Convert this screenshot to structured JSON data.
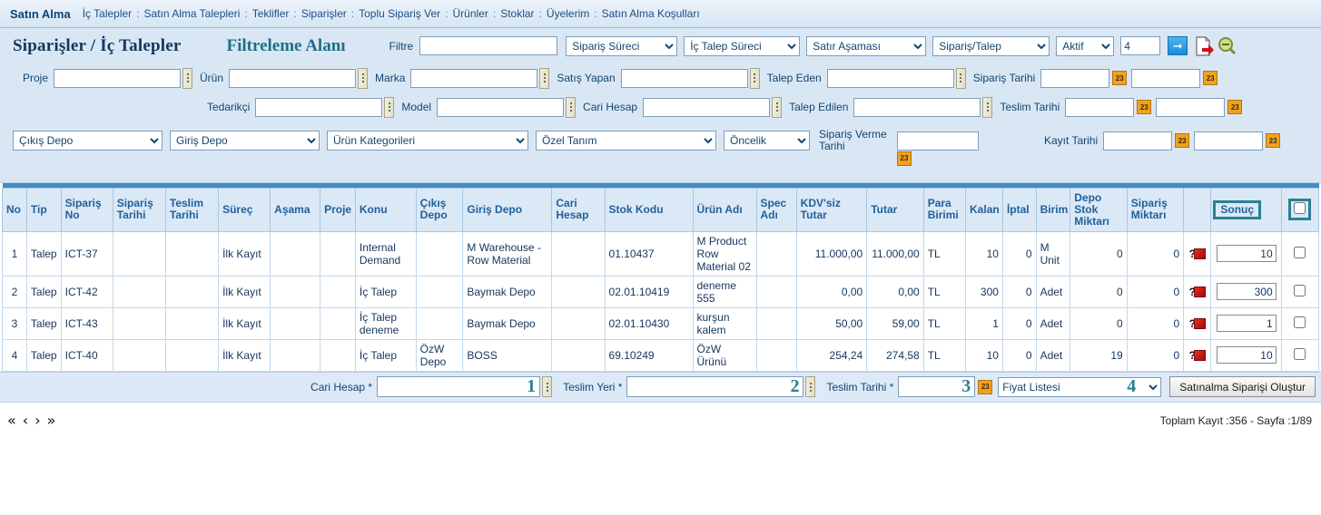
{
  "nav": {
    "brand": "Satın Alma",
    "separator": ":",
    "items": [
      "İç Talepler",
      "Satın Alma Talepleri",
      "Teklifler",
      "Siparişler",
      "Toplu Sipariş Ver",
      "Ürünler",
      "Stoklar",
      "Üyelerim",
      "Satın Alma Koşulları"
    ]
  },
  "header": {
    "page_title": "Siparişler / İç Talepler",
    "filter_area_title": "Filtreleme Alanı",
    "filter_label": "Filtre",
    "filter_value": "",
    "selects": [
      {
        "name": "siparis-sureci",
        "value": "Sipariş Süreci"
      },
      {
        "name": "ic-talep-sureci",
        "value": "İç Talep Süreci"
      },
      {
        "name": "satir-asamasi",
        "value": "Satır Aşaması"
      },
      {
        "name": "siparis-talep",
        "value": "Sipariş/Talep"
      },
      {
        "name": "aktif",
        "value": "Aktif"
      }
    ],
    "count_value": "4",
    "go_icon": "arrow-right-icon",
    "export_icon": "export-document-icon",
    "zoom_icon": "zoom-out-icon"
  },
  "filters": {
    "row1": [
      {
        "label": "Proje",
        "value": "",
        "picker": true
      },
      {
        "label": "Ürün",
        "value": "",
        "picker": true
      },
      {
        "label": "Marka",
        "value": "",
        "picker": true
      },
      {
        "label": "Satış Yapan",
        "value": "",
        "picker": true
      },
      {
        "label": "Talep Eden",
        "value": "",
        "picker": true
      }
    ],
    "row1_date": {
      "label": "Sipariş Tarihi",
      "from": "",
      "to": ""
    },
    "row2": [
      {
        "label": "Tedarikçi",
        "value": "",
        "picker": true
      },
      {
        "label": "Model",
        "value": "",
        "picker": true
      },
      {
        "label": "Cari Hesap",
        "value": "",
        "picker": true
      },
      {
        "label": "Talep Edilen",
        "value": "",
        "picker": true
      }
    ],
    "row2_date": {
      "label": "Teslim Tarihi",
      "from": "",
      "to": ""
    },
    "row3_selects": [
      {
        "name": "cikis-depo",
        "value": "Çıkış Depo"
      },
      {
        "name": "giris-depo",
        "value": "Giriş Depo"
      },
      {
        "name": "urun-kategorileri",
        "value": "Ürün Kategorileri"
      },
      {
        "name": "ozel-tanim",
        "value": "Özel Tanım"
      },
      {
        "name": "oncelik",
        "value": "Öncelik"
      }
    ],
    "siparis_verme_tarihi": {
      "label": "Sipariş Verme Tarihi",
      "value": ""
    },
    "kayit_tarihi": {
      "label": "Kayıt Tarihi",
      "from": "",
      "to": ""
    },
    "calendar_icon_label": "23"
  },
  "table": {
    "columns": [
      "No",
      "Tip",
      "Sipariş No",
      "Sipariş Tarihi",
      "Teslim Tarihi",
      "Süreç",
      "Aşama",
      "Proje",
      "Konu",
      "Çıkış Depo",
      "Giriş Depo",
      "Cari Hesap",
      "Stok Kodu",
      "Ürün Adı",
      "Spec Adı",
      "KDV'siz Tutar",
      "Tutar",
      "Para Birimi",
      "Kalan",
      "İptal",
      "Birim",
      "Depo Stok Miktarı",
      "Sipariş Miktarı",
      "",
      "Sonuç",
      ""
    ],
    "select_all_checked": false,
    "rows": [
      {
        "no": "1",
        "tip": "Talep",
        "siparis_no": "ICT-37",
        "siparis_tarihi": "",
        "teslim_tarihi": "",
        "surec": "İlk Kayıt",
        "asama": "",
        "proje": "",
        "konu": "Internal Demand",
        "cikis_depo": "",
        "giris_depo": "M Warehouse - Row Material",
        "cari_hesap": "",
        "stok_kodu": "01.10437",
        "urun_adi": "M Product Row Material 02",
        "spec_adi": "",
        "kdvsiz_tutar": "11.000,00",
        "tutar": "11.000,00",
        "para_birimi": "TL",
        "kalan": "10",
        "iptal": "0",
        "birim": "M Unit",
        "depo_stok_miktari": "0",
        "siparis_miktari": "0",
        "status_icon": "question-box-icon",
        "sonuc": "10",
        "checked": false
      },
      {
        "no": "2",
        "tip": "Talep",
        "siparis_no": "ICT-42",
        "siparis_tarihi": "",
        "teslim_tarihi": "",
        "surec": "İlk Kayıt",
        "asama": "",
        "proje": "",
        "konu": "İç Talep",
        "cikis_depo": "",
        "giris_depo": "Baymak Depo",
        "cari_hesap": "",
        "stok_kodu": "02.01.10419",
        "urun_adi": "deneme 555",
        "spec_adi": "",
        "kdvsiz_tutar": "0,00",
        "tutar": "0,00",
        "para_birimi": "TL",
        "kalan": "300",
        "iptal": "0",
        "birim": "Adet",
        "depo_stok_miktari": "0",
        "siparis_miktari": "0",
        "status_icon": "question-box-icon",
        "sonuc": "300",
        "checked": false
      },
      {
        "no": "3",
        "tip": "Talep",
        "siparis_no": "ICT-43",
        "siparis_tarihi": "",
        "teslim_tarihi": "",
        "surec": "İlk Kayıt",
        "asama": "",
        "proje": "",
        "konu": "İç Talep deneme",
        "cikis_depo": "",
        "giris_depo": "Baymak Depo",
        "cari_hesap": "",
        "stok_kodu": "02.01.10430",
        "urun_adi": "kurşun kalem",
        "spec_adi": "",
        "kdvsiz_tutar": "50,00",
        "tutar": "59,00",
        "para_birimi": "TL",
        "kalan": "1",
        "iptal": "0",
        "birim": "Adet",
        "depo_stok_miktari": "0",
        "siparis_miktari": "0",
        "status_icon": "question-box-icon",
        "sonuc": "1",
        "checked": false
      },
      {
        "no": "4",
        "tip": "Talep",
        "siparis_no": "ICT-40",
        "siparis_tarihi": "",
        "teslim_tarihi": "",
        "surec": "İlk Kayıt",
        "asama": "",
        "proje": "",
        "konu": "İç Talep",
        "cikis_depo": "ÖzW Depo",
        "giris_depo": "BOSS",
        "cari_hesap": "",
        "stok_kodu": "69.10249",
        "urun_adi": "ÖzW Ürünü",
        "spec_adi": "",
        "kdvsiz_tutar": "254,24",
        "tutar": "274,58",
        "para_birimi": "TL",
        "kalan": "10",
        "iptal": "0",
        "birim": "Adet",
        "depo_stok_miktari": "19",
        "siparis_miktari": "0",
        "status_icon": "question-box-icon",
        "sonuc": "10",
        "checked": false
      }
    ]
  },
  "actionbar": {
    "cari_hesap_label": "Cari Hesap *",
    "cari_hesap_value": "1",
    "teslim_yeri_label": "Teslim Yeri *",
    "teslim_yeri_value": "2",
    "teslim_tarihi_label": "Teslim Tarihi *",
    "teslim_tarihi_value": "3",
    "fiyat_listesi_label": "Fiyat Listesi",
    "fiyat_listesi_value": "4",
    "submit_label": "Satınalma Siparişi Oluştur"
  },
  "footer": {
    "first_icon": "«",
    "prev_icon": "‹",
    "next_icon": "›",
    "last_icon": "»",
    "totals": "Toplam Kayıt :356 -  Sayfa :1/89"
  },
  "colors": {
    "accent_teal": "#2b7f93",
    "header_blue": "#21619b",
    "panel_blue": "#d9e7f5",
    "link_blue": "#2f4fd0"
  }
}
